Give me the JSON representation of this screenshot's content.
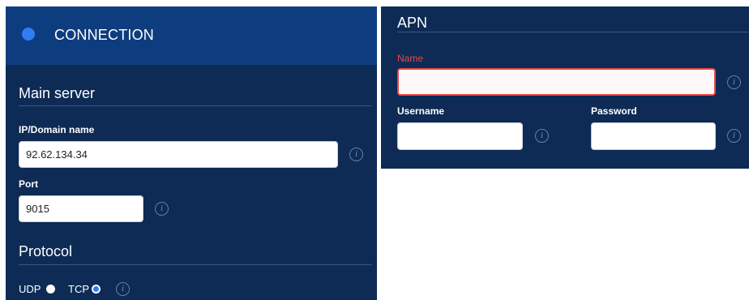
{
  "connection": {
    "title": "CONNECTION",
    "main_server": {
      "title": "Main server",
      "ip_label": "IP/Domain name",
      "ip_value": "92.62.134.34",
      "port_label": "Port",
      "port_value": "9015"
    },
    "protocol": {
      "title": "Protocol",
      "options": [
        {
          "label": "UDP",
          "selected": false
        },
        {
          "label": "TCP",
          "selected": true
        }
      ]
    }
  },
  "apn": {
    "title": "APN",
    "name_label": "Name",
    "name_value": "",
    "username_label": "Username",
    "username_value": "",
    "password_label": "Password",
    "password_value": ""
  },
  "icons": {
    "info": "i"
  },
  "colors": {
    "panel_bg": "#0d2b55",
    "header_bg": "#0e3d7f",
    "accent": "#2f7df2",
    "error": "#e8484a"
  }
}
